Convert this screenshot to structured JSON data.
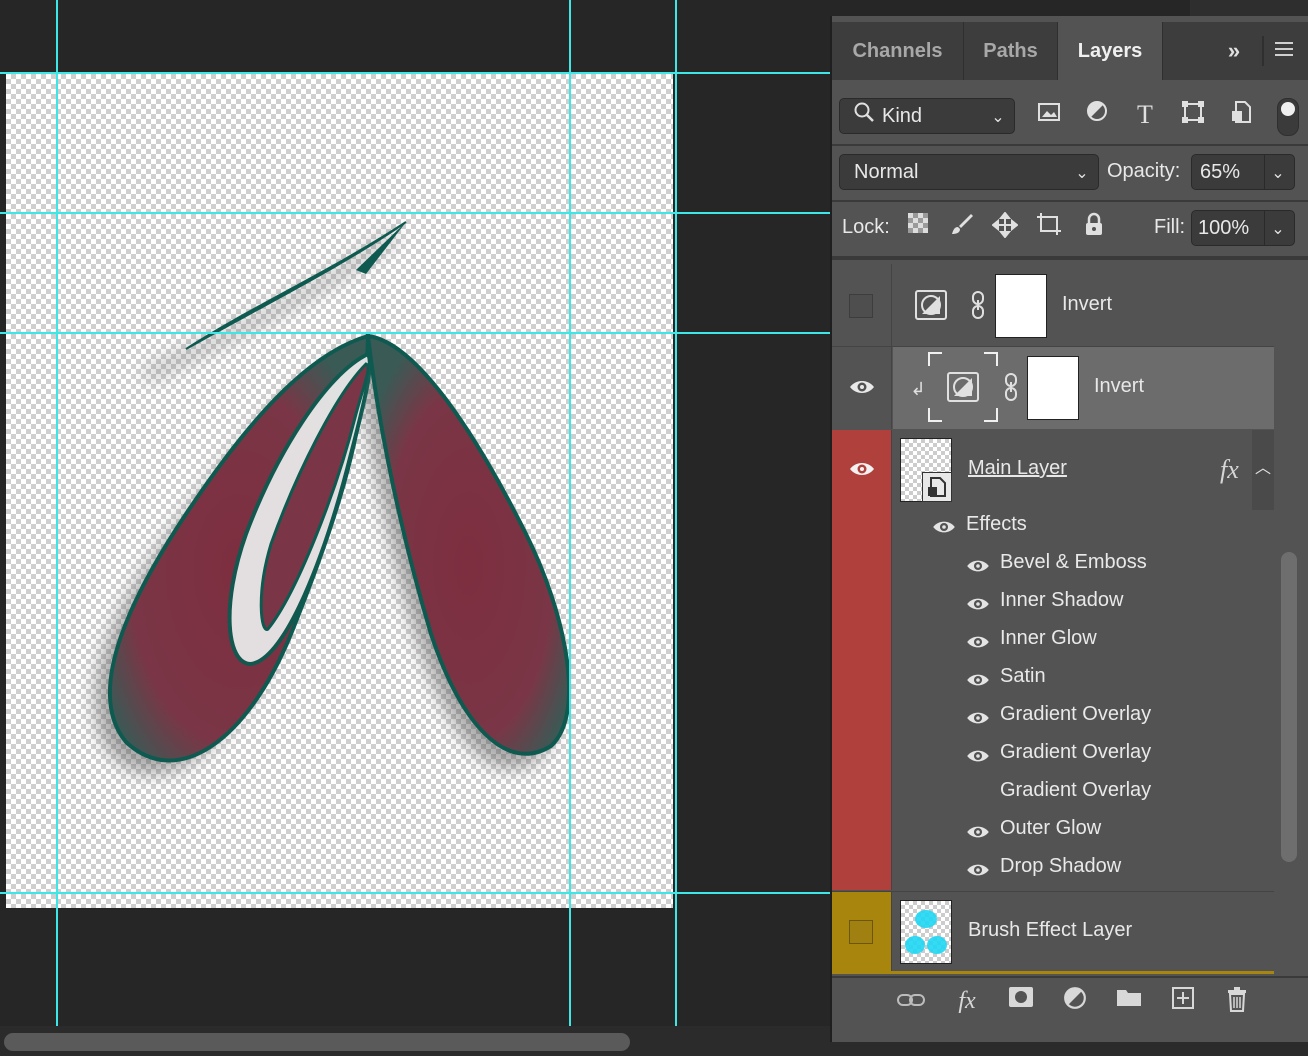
{
  "panel": {
    "tabs": [
      {
        "label": "Channels",
        "active": false
      },
      {
        "label": "Paths",
        "active": false
      },
      {
        "label": "Layers",
        "active": true
      }
    ],
    "filter": {
      "kind_label": "Kind"
    },
    "blend": {
      "mode": "Normal",
      "opacity_label": "Opacity:",
      "opacity_value": "65%"
    },
    "lock": {
      "label": "Lock:",
      "fill_label": "Fill:",
      "fill_value": "100%"
    },
    "layers": [
      {
        "name": "Invert",
        "visible": false,
        "type": "adjustment"
      },
      {
        "name": "Invert",
        "visible": true,
        "type": "adjustment",
        "selected": true,
        "clipped": true
      },
      {
        "name": "Main Layer",
        "visible": true,
        "type": "smart-object",
        "color_tag": "#b0403c",
        "fx": "fx"
      },
      {
        "name": "Brush Effect Layer",
        "visible": false,
        "type": "pixel",
        "color_tag": "#a8860e"
      }
    ],
    "effects_header": "Effects",
    "effects": [
      {
        "label": "Bevel & Emboss",
        "visible": true
      },
      {
        "label": "Inner Shadow",
        "visible": true
      },
      {
        "label": "Inner Glow",
        "visible": true
      },
      {
        "label": "Satin",
        "visible": true
      },
      {
        "label": "Gradient Overlay",
        "visible": true
      },
      {
        "label": "Gradient Overlay",
        "visible": true
      },
      {
        "label": "Gradient Overlay",
        "visible": false
      },
      {
        "label": "Outer Glow",
        "visible": true
      },
      {
        "label": "Drop Shadow",
        "visible": true
      }
    ]
  },
  "colors": {
    "guide": "#3ee6e6",
    "main_layer_tag": "#b0403c",
    "brush_layer_tag": "#a8860e",
    "shape_fill": "#7a3444",
    "shape_stroke": "#0e5a50"
  }
}
